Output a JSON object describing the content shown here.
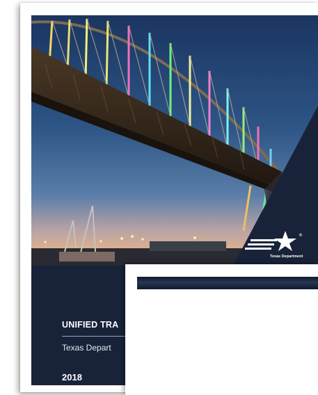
{
  "cover": {
    "title": "UNIFIED TRA",
    "agency": "Texas Depart",
    "year": "2018"
  },
  "logo": {
    "lettering": "Texas Department",
    "registered_mark": "®"
  },
  "colors": {
    "navy": "#18233a",
    "sky_top": "#1f3a63",
    "sky_horizon": "#e0b08c",
    "bridge_steel": "#3a2a1c"
  },
  "icons": {
    "logo": "txdot-star-logo-icon"
  }
}
